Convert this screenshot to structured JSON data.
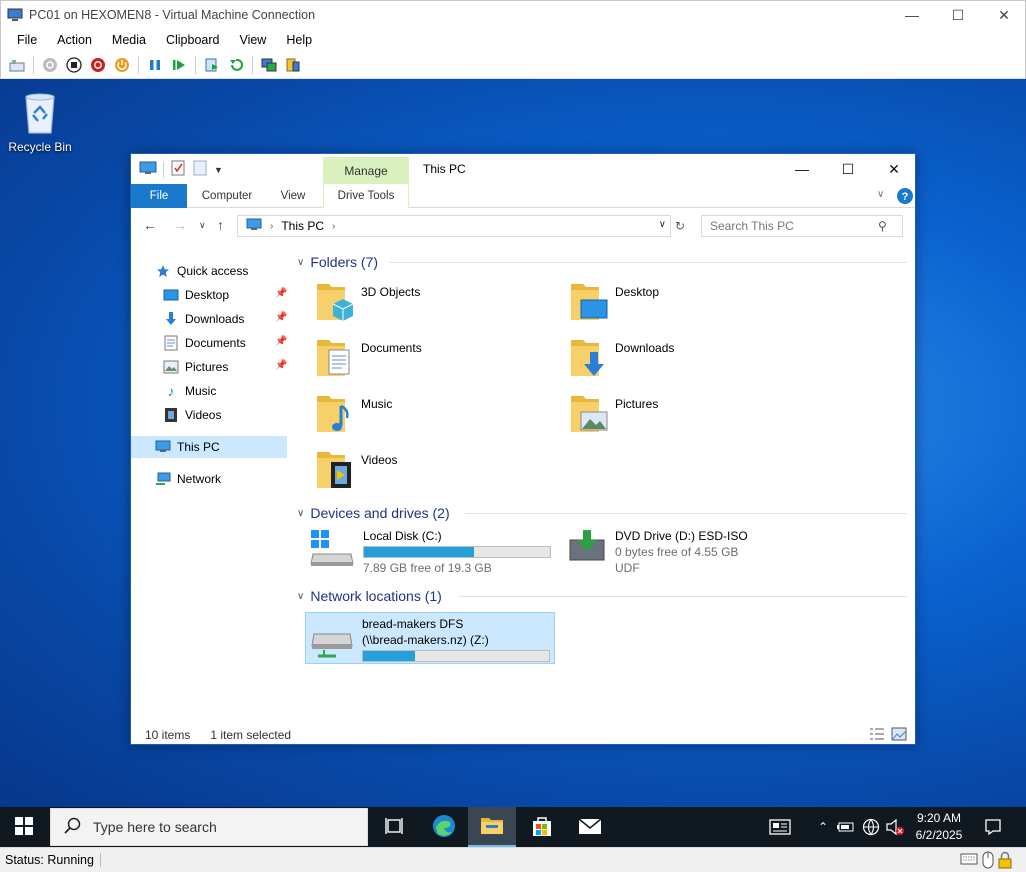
{
  "vm": {
    "title": "PC01 on HEXOMEN8 - Virtual Machine Connection",
    "menu": [
      "File",
      "Action",
      "Media",
      "Clipboard",
      "View",
      "Help"
    ],
    "toolbar_icons": [
      "ctrl-alt-del-icon",
      "start-icon",
      "turn-off-icon",
      "shutdown-icon",
      "power-icon",
      "pause-icon",
      "resume-icon",
      "checkpoint-icon",
      "revert-icon",
      "enhanced-session-icon",
      "share-icon"
    ],
    "status": "Status: Running"
  },
  "desktop": {
    "recycle_bin_label": "Recycle Bin"
  },
  "explorer": {
    "title": "This PC",
    "manage_tab": "Manage",
    "ribbon_tabs": {
      "file": "File",
      "computer": "Computer",
      "view": "View",
      "drive_tools": "Drive Tools"
    },
    "address": {
      "root": "This PC"
    },
    "search_placeholder": "Search This PC",
    "nav": {
      "quick_access": "Quick access",
      "items": [
        "Desktop",
        "Downloads",
        "Documents",
        "Pictures",
        "Music",
        "Videos"
      ],
      "this_pc": "This PC",
      "network": "Network"
    },
    "groups": {
      "folders": "Folders (7)",
      "devices": "Devices and drives (2)",
      "network": "Network locations (1)"
    },
    "folders": [
      "3D Objects",
      "Desktop",
      "Documents",
      "Downloads",
      "Music",
      "Pictures",
      "Videos"
    ],
    "drives": [
      {
        "name": "Local Disk (C:)",
        "free": "7.89 GB free of 19.3 GB",
        "used_fraction": 0.59
      },
      {
        "name": "DVD Drive (D:) ESD-ISO",
        "free": "0 bytes free of 4.55 GB",
        "fs": "UDF"
      }
    ],
    "network_location": {
      "name_line1": "bread-makers DFS",
      "name_line2": "(\\\\bread-makers.nz) (Z:)",
      "used_fraction": 0.28
    },
    "status": {
      "items": "10 items",
      "selected": "1 item selected"
    }
  },
  "taskbar": {
    "search_placeholder": "Type here to search",
    "time": "9:20 AM",
    "date": "6/2/2025"
  },
  "colors": {
    "accent": "#1979ca",
    "selection": "#cce8ff",
    "group_header": "#1e3287",
    "desktop_blue": "#0a63d0",
    "taskbar": "#101820"
  }
}
